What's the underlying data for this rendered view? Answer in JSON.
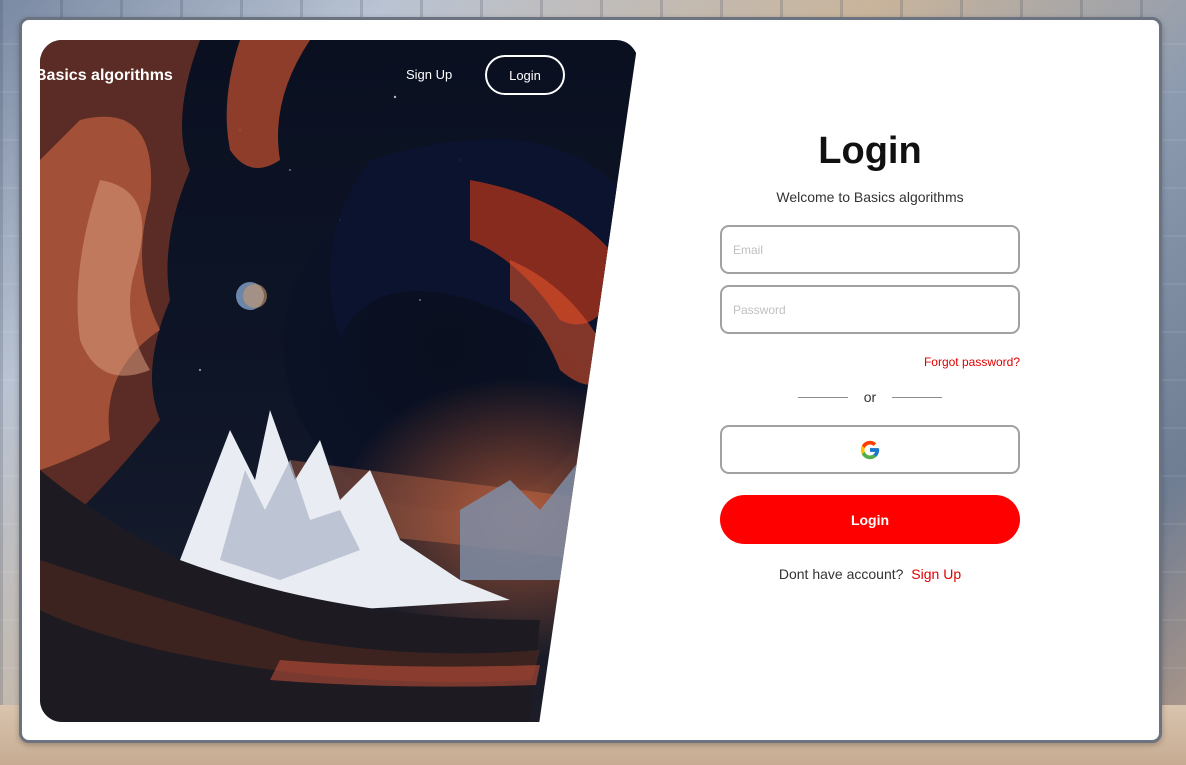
{
  "brand": "Basics algorithms",
  "nav": {
    "signup_label": "Sign Up",
    "login_label": "Login"
  },
  "form": {
    "title": "Login",
    "subtitle": "Welcome to Basics algorithms",
    "email_placeholder": "Email",
    "password_placeholder": "Password",
    "forgot_label": "Forgot password?",
    "divider_label": "or",
    "google_icon": "google-icon",
    "login_button_label": "Login",
    "footer_text": "Dont have account?",
    "footer_link": "Sign Up"
  },
  "colors": {
    "accent": "#ff0000",
    "link": "#e00000"
  }
}
